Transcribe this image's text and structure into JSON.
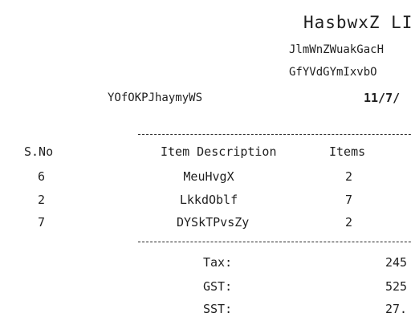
{
  "receipt": {
    "shop_name": "HasbwxZ LIF",
    "address_line_1": "JlmWnZWuakGacH",
    "address_line_2": "GfYVdGYmIxvbO",
    "cashier": "YOfOKPJhaymyWS",
    "date": "11/7/"
  },
  "table": {
    "headers": {
      "sno": "S.No",
      "description": "Item Description",
      "items": "Items"
    },
    "rows": [
      {
        "sno": "6",
        "description": "MeuHvgX",
        "items": "2"
      },
      {
        "sno": "2",
        "description": "LkkdOblf",
        "items": "7"
      },
      {
        "sno": "7",
        "description": "DYSkTPvsZy",
        "items": "2"
      }
    ]
  },
  "summary": [
    {
      "label": "Tax:",
      "value": "245"
    },
    {
      "label": "GST:",
      "value": "525"
    },
    {
      "label": "SST:",
      "value": "27."
    }
  ]
}
